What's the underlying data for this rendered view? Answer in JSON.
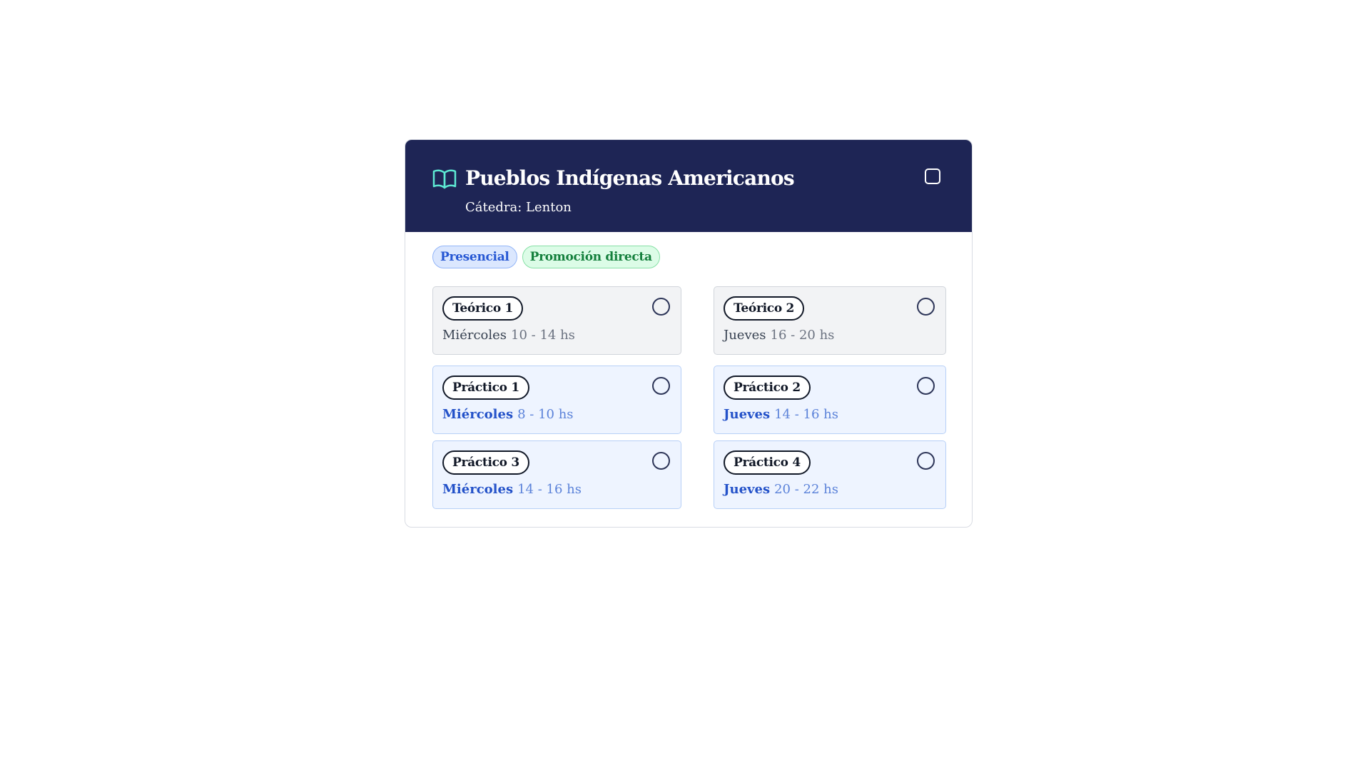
{
  "course": {
    "title": "Pueblos Indígenas Americanos",
    "subtitle": "Cátedra: Lenton",
    "icon": "book-open-icon",
    "accent_color": "#5eead4",
    "header_color": "#1e2555"
  },
  "badges": [
    {
      "label": "Presencial",
      "color": "#2657d3"
    },
    {
      "label": "Promoción directa",
      "color": "#15803d"
    }
  ],
  "slots": [
    {
      "label": "Teórico 1",
      "day": "Miércoles",
      "time": "10 - 14 hs",
      "kind": "teorico"
    },
    {
      "label": "Teórico 2",
      "day": "Jueves",
      "time": "16 - 20 hs",
      "kind": "teorico"
    },
    {
      "label": "Práctico 1",
      "day": "Miércoles",
      "time": "8 - 10 hs",
      "kind": "practico"
    },
    {
      "label": "Práctico 2",
      "day": "Jueves",
      "time": "14 - 16 hs",
      "kind": "practico"
    },
    {
      "label": "Práctico 3",
      "day": "Miércoles",
      "time": "14 - 16 hs",
      "kind": "practico"
    },
    {
      "label": "Práctico 4",
      "day": "Jueves",
      "time": "20 - 22 hs",
      "kind": "practico"
    }
  ]
}
